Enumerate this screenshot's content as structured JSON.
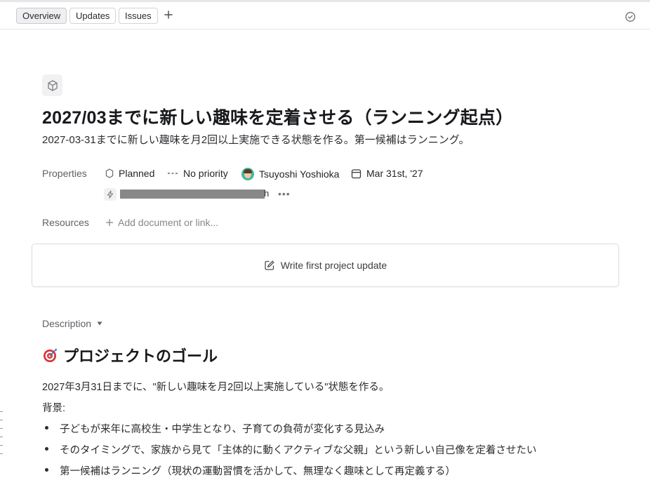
{
  "tabs": [
    {
      "label": "Overview",
      "active": true
    },
    {
      "label": "Updates",
      "active": false
    },
    {
      "label": "Issues",
      "active": false
    }
  ],
  "project": {
    "title": "2027/03までに新しい趣味を定着させる（ランニング起点）",
    "summary": "2027-03-31までに新しい趣味を月2回以上実施できる状態を作る。第一候補はランニング。"
  },
  "properties": {
    "label": "Properties",
    "status": "Planned",
    "priority": "No priority",
    "lead": "Tsuyoshi Yoshioka",
    "target_date": "Mar 31st, '27",
    "redacted_tail": "h"
  },
  "resources": {
    "label": "Resources",
    "add_placeholder": "Add document or link..."
  },
  "update": {
    "label": "Write first project update"
  },
  "description": {
    "label": "Description",
    "heading": "プロジェクトのゴール",
    "goal_line": "2027年3月31日までに、\"新しい趣味を月2回以上実施している\"状態を作る。",
    "background_label": "背景:",
    "bullets": [
      "子どもが来年に高校生・中学生となり、子育ての負荷が変化する見込み",
      "そのタイミングで、家族から見て「主体的に動くアクティブな父親」という新しい自己像を定着させたい",
      "第一候補はランニング（現状の運動習慣を活かして、無理なく趣味として再定義する）"
    ]
  },
  "icons": {
    "add_tab": "plus-icon",
    "comment": "chat-bubble-icon",
    "project": "cube-icon",
    "status": "hexagon-outline-icon",
    "priority": "dashed-line-icon",
    "calendar": "calendar-icon",
    "integration": "lightning-icon",
    "more": "ellipsis-icon",
    "edit": "pencil-square-icon",
    "goal": "dart-target-icon"
  }
}
